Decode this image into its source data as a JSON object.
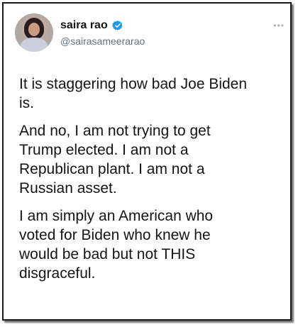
{
  "tweet": {
    "author": {
      "display_name": "saira rao",
      "handle": "@sairasameerarao",
      "verified": true
    },
    "more_icon": "ellipsis-icon",
    "paragraphs": [
      "It is staggering how bad Joe Biden\nis.",
      "And no, I am not trying to get\nTrump elected. I am not a\nRepublican plant. I am not a\nRussian asset.",
      "I am simply an American who\nvoted for Biden who knew he\nwould be bad but not THIS\ndisgraceful."
    ]
  },
  "colors": {
    "verified_badge": "#1d9bf0",
    "text": "#141414",
    "handle": "#66707a"
  }
}
